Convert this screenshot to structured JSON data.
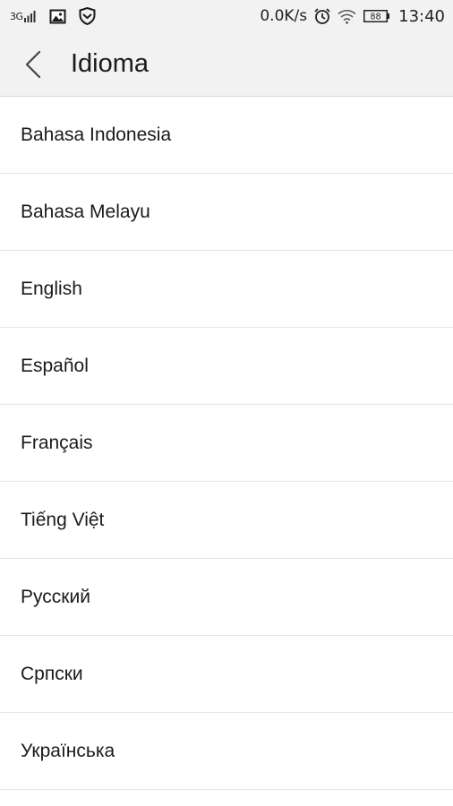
{
  "status_bar": {
    "network_type": "3G",
    "signal_icon": "signal-bars-icon",
    "notification_icons": [
      "gallery-icon",
      "shield-icon"
    ],
    "data_speed": "0.0K/s",
    "alarm_icon": "alarm-clock-icon",
    "wifi_icon": "wifi-icon",
    "battery_level": "88",
    "time": "13:40"
  },
  "header": {
    "back_icon": "chevron-left-icon",
    "title": "Idioma"
  },
  "languages": [
    {
      "label": "Bahasa Indonesia"
    },
    {
      "label": "Bahasa Melayu"
    },
    {
      "label": "English"
    },
    {
      "label": "Español"
    },
    {
      "label": "Français"
    },
    {
      "label": "Tiếng Việt"
    },
    {
      "label": "Русский"
    },
    {
      "label": "Српски"
    },
    {
      "label": "Українська"
    }
  ],
  "colors": {
    "header_bg": "#f2f2f2",
    "list_bg": "#ffffff",
    "divider": "#e6e6e6",
    "text": "#1a1a1a"
  }
}
